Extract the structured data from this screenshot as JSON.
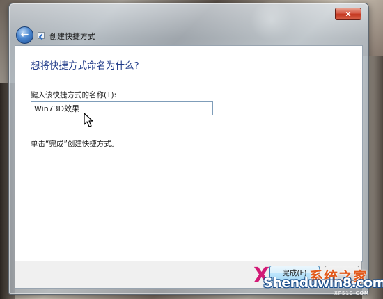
{
  "window": {
    "title": "创建快捷方式",
    "close_label": "x"
  },
  "content": {
    "heading": "想将快捷方式命名为什么?",
    "field_label": "键入该快捷方式的名称(T):",
    "name_value": "Win73D效果",
    "hint": "单击“完成”创建快捷方式。"
  },
  "footer": {
    "finish_label": "完成(F)"
  },
  "watermark": {
    "chinese": "系统之家",
    "english": "Shenduwin8.com",
    "sub": "XP510.COM"
  },
  "colors": {
    "heading": "#1f3a88",
    "close": "#c3361f"
  },
  "icons": [
    "close-icon",
    "back-arrow-icon",
    "shortcut-app-icon",
    "mouse-cursor-icon"
  ]
}
